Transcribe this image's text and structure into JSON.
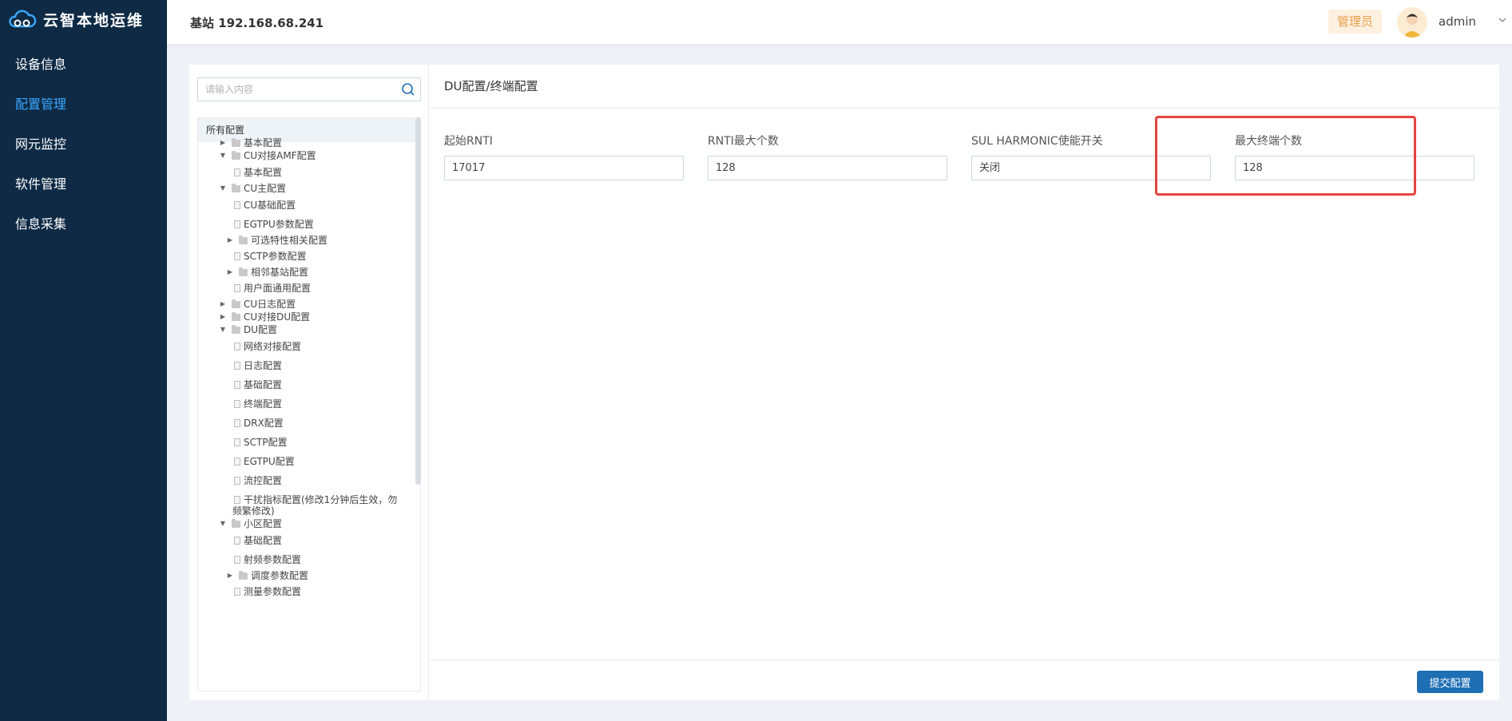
{
  "app": {
    "title": "云智本地运维"
  },
  "nav": {
    "items": [
      {
        "label": "设备信息"
      },
      {
        "label": "配置管理"
      },
      {
        "label": "网元监控"
      },
      {
        "label": "软件管理"
      },
      {
        "label": "信息采集"
      }
    ],
    "active_index": 1
  },
  "header": {
    "station": "基站 192.168.68.241",
    "role": "管理员",
    "username": "admin"
  },
  "search": {
    "placeholder": "请输入内容",
    "icon": "search-icon"
  },
  "tree": {
    "root": "所有配置",
    "nodes": [
      {
        "label": "基本配置",
        "type": "folder",
        "state": "collapsed"
      },
      {
        "label": "CU对接AMF配置",
        "type": "folder",
        "state": "expanded"
      },
      {
        "label": "基本配置",
        "type": "file"
      },
      {
        "label": "CU主配置",
        "type": "folder",
        "state": "expanded"
      },
      {
        "label": "CU基础配置",
        "type": "file"
      },
      {
        "label": "EGTPU参数配置",
        "type": "file"
      },
      {
        "label": "可选特性相关配置",
        "type": "folder",
        "state": "collapsed"
      },
      {
        "label": "SCTP参数配置",
        "type": "file"
      },
      {
        "label": "相邻基站配置",
        "type": "folder",
        "state": "collapsed"
      },
      {
        "label": "用户面通用配置",
        "type": "file"
      },
      {
        "label": "CU日志配置",
        "type": "folder",
        "state": "collapsed"
      },
      {
        "label": "CU对接DU配置",
        "type": "folder",
        "state": "collapsed"
      },
      {
        "label": "DU配置",
        "type": "folder",
        "state": "expanded"
      },
      {
        "label": "网络对接配置",
        "type": "file"
      },
      {
        "label": "日志配置",
        "type": "file"
      },
      {
        "label": "基础配置",
        "type": "file"
      },
      {
        "label": "终端配置",
        "type": "file",
        "selected": true
      },
      {
        "label": "DRX配置",
        "type": "file"
      },
      {
        "label": "SCTP配置",
        "type": "file"
      },
      {
        "label": "EGTPU配置",
        "type": "file"
      },
      {
        "label": "流控配置",
        "type": "file"
      },
      {
        "label": "干扰指标配置(修改1分钟后生效，勿",
        "label_line2": "频繁修改)",
        "type": "file"
      },
      {
        "label": "小区配置",
        "type": "folder",
        "state": "expanded"
      },
      {
        "label": "基础配置",
        "type": "file"
      },
      {
        "label": "射频参数配置",
        "type": "file"
      },
      {
        "label": "调度参数配置",
        "type": "folder",
        "state": "collapsed"
      },
      {
        "label": "测量参数配置",
        "type": "file"
      }
    ]
  },
  "form": {
    "title": "DU配置/终端配置",
    "fields": [
      {
        "label": "起始RNTI",
        "value": "17017"
      },
      {
        "label": "RNTI最大个数",
        "value": "128"
      },
      {
        "label": "SUL HARMONIC使能开关",
        "value": "关闭"
      },
      {
        "label": "最大终端个数",
        "value": "128"
      }
    ],
    "highlight_color": "#e64340",
    "submit_label": "提交配置"
  },
  "colors": {
    "sidebar": "#0e2a45",
    "accent": "#3ba8ff",
    "button": "#1f6fb5"
  }
}
